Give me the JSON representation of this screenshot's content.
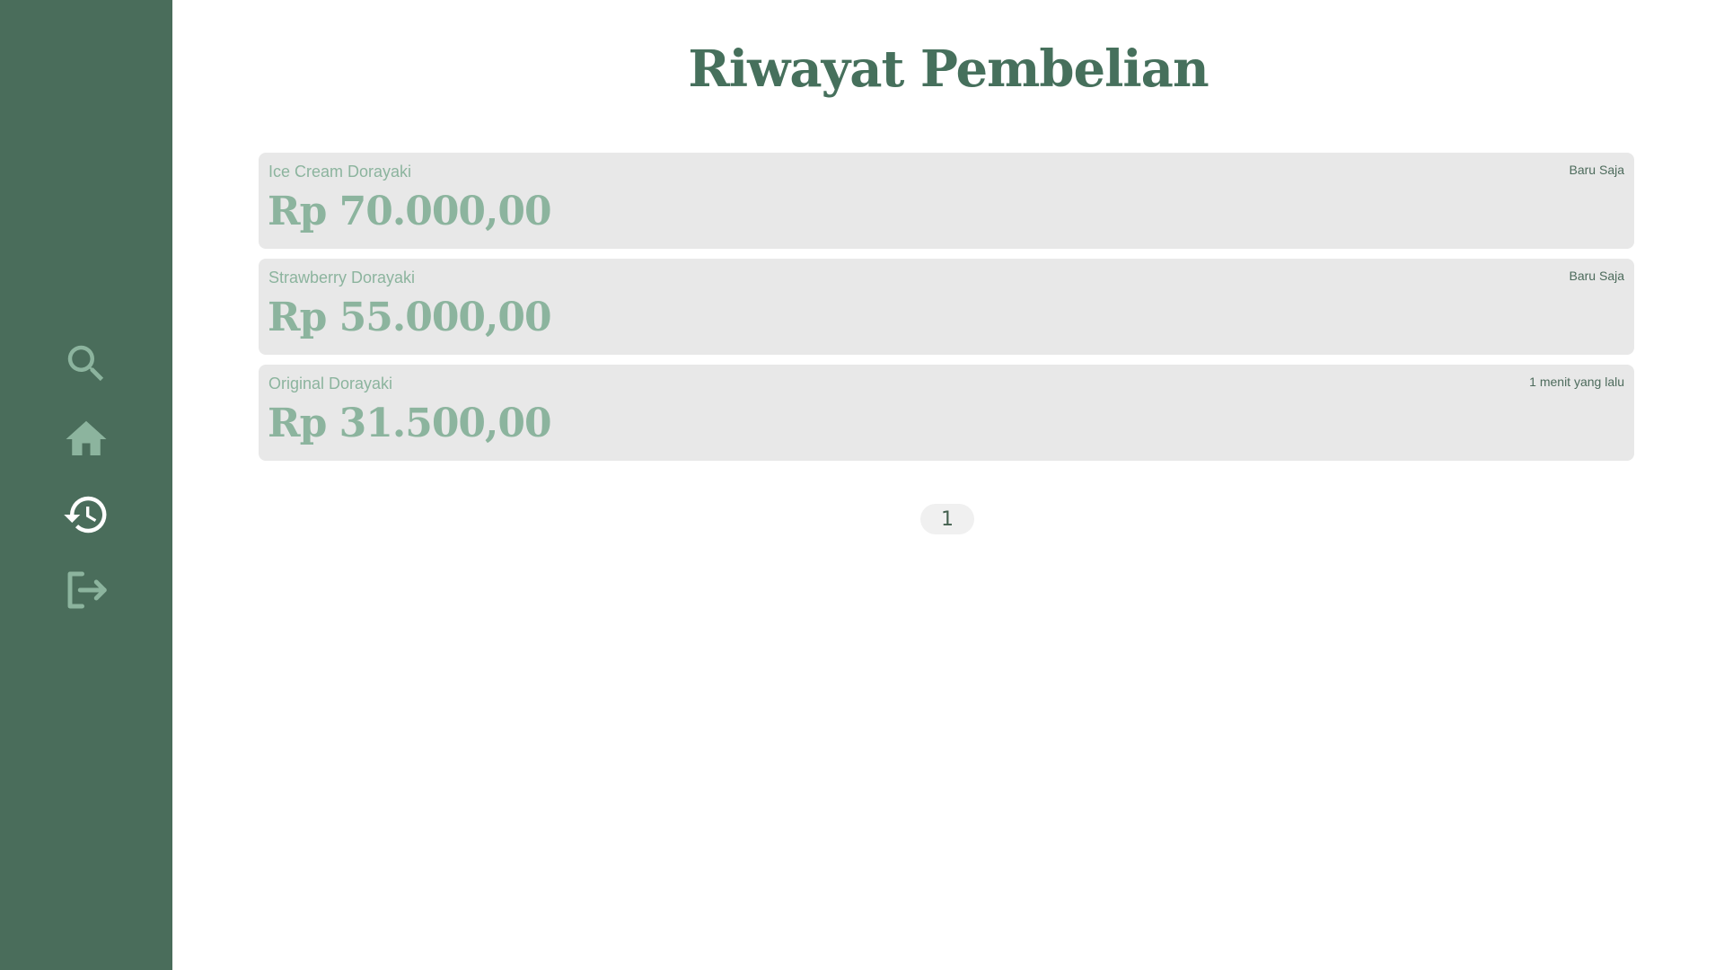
{
  "sidebar": {
    "items": [
      {
        "icon": "search-icon",
        "color": "#8cb49e",
        "active": false
      },
      {
        "icon": "home-icon",
        "color": "#8cb49e",
        "active": false
      },
      {
        "icon": "history-icon",
        "color": "#ffffff",
        "active": true
      },
      {
        "icon": "logout-icon",
        "color": "#8cb49e",
        "active": false
      }
    ]
  },
  "main": {
    "title": "Riwayat Pembelian",
    "purchases": [
      {
        "name": "Ice Cream Dorayaki",
        "time": "Baru Saja",
        "price": "Rp 70.000,00"
      },
      {
        "name": "Strawberry Dorayaki",
        "time": "Baru Saja",
        "price": "Rp 55.000,00"
      },
      {
        "name": "Original Dorayaki",
        "time": "1 menit yang lalu",
        "price": "Rp 31.500,00"
      }
    ],
    "pagination": {
      "current_page": "1"
    }
  },
  "colors": {
    "sidebar_bg": "#4a6d5b",
    "title": "#46705c",
    "accent": "#8cb49e",
    "card_bg": "#e8e8e8",
    "timestamp": "#4d6b5c"
  }
}
